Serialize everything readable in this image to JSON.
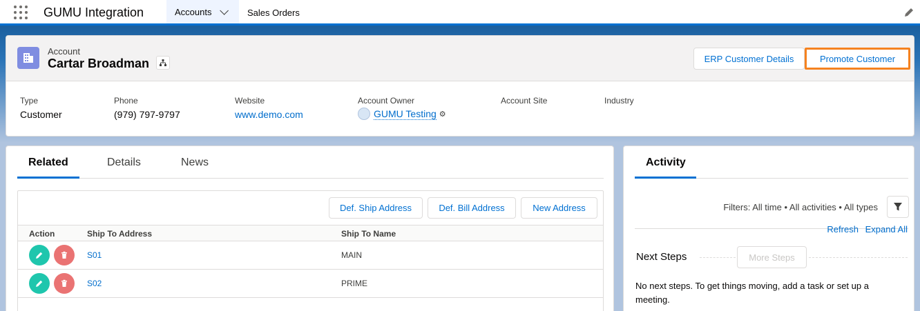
{
  "topnav": {
    "app_name": "GUMU Integration",
    "tabs": [
      {
        "label": "Accounts",
        "active": true
      },
      {
        "label": "Sales Orders",
        "active": false
      }
    ]
  },
  "header": {
    "object_label": "Account",
    "record_name": "Cartar Broadman",
    "actions": {
      "erp_label": "ERP Customer Details",
      "promote_label": "Promote Customer"
    },
    "fields": {
      "type_label": "Type",
      "type_value": "Customer",
      "phone_label": "Phone",
      "phone_value": "(979) 797-9797",
      "website_label": "Website",
      "website_value": "www.demo.com",
      "owner_label": "Account Owner",
      "owner_value": "GUMU Testing",
      "site_label": "Account Site",
      "site_value": "",
      "industry_label": "Industry",
      "industry_value": ""
    }
  },
  "related": {
    "tabs": [
      "Related",
      "Details",
      "News"
    ],
    "buttons": {
      "ship": "Def. Ship Address",
      "bill": "Def. Bill Address",
      "new": "New Address"
    },
    "columns": [
      "Action",
      "Ship To Address",
      "Ship To Name"
    ],
    "rows": [
      {
        "address": "S01",
        "name": "MAIN"
      },
      {
        "address": "S02",
        "name": "PRIME"
      }
    ]
  },
  "activity": {
    "tab": "Activity",
    "filters": "Filters: All time • All activities • All types",
    "refresh": "Refresh",
    "expand_all": "Expand All",
    "next_steps": "Next Steps",
    "more_steps": "More Steps",
    "no_steps": "No next steps. To get things moving, add a task or set up a meeting."
  },
  "colors": {
    "brand_blue": "#0070d2",
    "highlight_orange": "#f5821f",
    "edit_green": "#1fc6ad",
    "delete_red": "#ea7373",
    "account_icon": "#7f8de1"
  }
}
